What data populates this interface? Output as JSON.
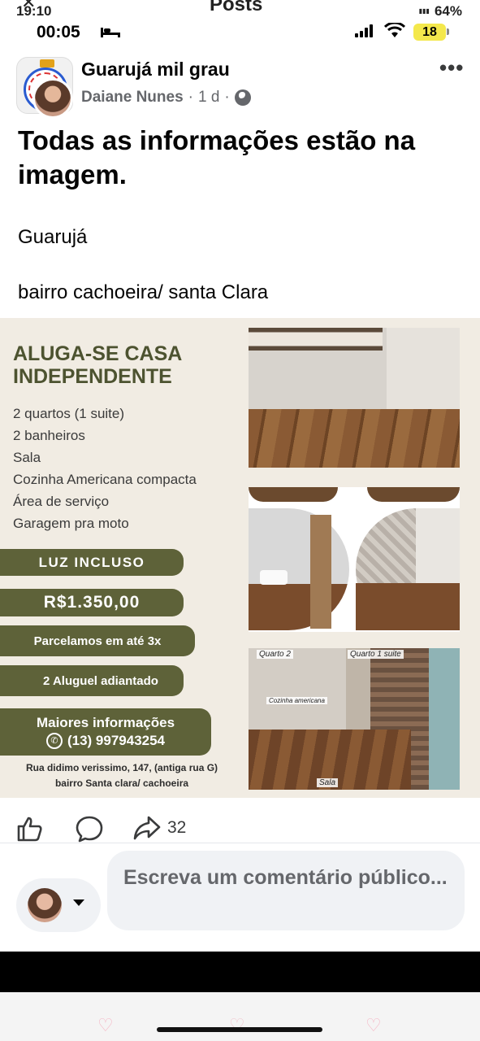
{
  "status_back": {
    "time": "19:10",
    "title": "Posts",
    "battery": "64%"
  },
  "status": {
    "time": "00:05",
    "battery": "18"
  },
  "post": {
    "group_name": "Guarujá mil grau",
    "author": "Daiane Nunes",
    "separator": "·",
    "age": "1 d",
    "more": "•••",
    "title": "Todas as informações estão na imagem.",
    "line1": "Guarujá",
    "line2": "bairro cachoeira/ santa Clara"
  },
  "flyer": {
    "heading_line1": "ALUGA-SE CASA",
    "heading_line2": "INDEPENDENTE",
    "features": [
      "2 quartos (1 suite)",
      "2 banheiros",
      "Sala",
      "Cozinha Americana compacta",
      "Área de serviço",
      "Garagem pra moto"
    ],
    "luz": "LUZ INCLUSO",
    "price": "R$1.350,00",
    "installments": "Parcelamos em até 3x",
    "advance": "2  Aluguel adiantado",
    "info_label": "Maiores informações",
    "phone": "(13) 997943254",
    "address_line1": "Rua didimo verissimo, 147, (antiga rua G)",
    "address_line2": "bairro Santa clara/ cachoeira",
    "photo_labels": {
      "quarto2": "Quarto 2",
      "quarto1": "Quarto 1 suite",
      "cozinha": "Cozinha americana",
      "sala": "Sala"
    }
  },
  "actions": {
    "share_count": "32"
  },
  "composer": {
    "placeholder": "Escreva um comentário público..."
  },
  "icons": {
    "like": "thumbs-up-icon",
    "comment": "comment-bubble-icon",
    "share": "share-arrow-icon",
    "privacy": "globe-icon",
    "phone": "phone-icon"
  },
  "colors": {
    "olive": "#5e6239",
    "flyer_bg": "#f1ece3",
    "muted_text": "#65676b"
  }
}
